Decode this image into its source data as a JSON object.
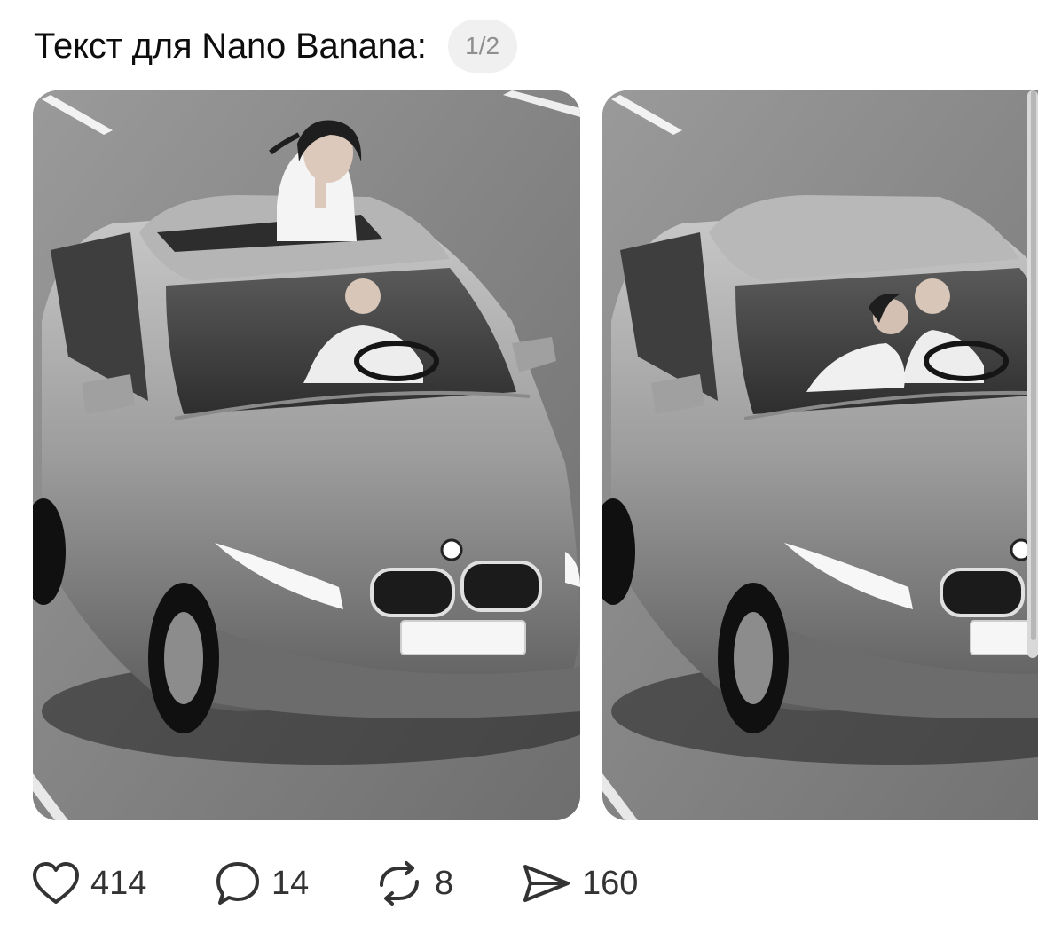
{
  "post": {
    "title": "Текст для Nano Banana:",
    "page_counter": "1/2"
  },
  "carousel": {
    "images": [
      {
        "description_name": "car-photo-woman-in-sunroof"
      },
      {
        "description_name": "car-photo-couple-inside"
      }
    ]
  },
  "actions": {
    "likes": "414",
    "comments": "14",
    "reposts": "8",
    "shares": "160"
  },
  "icons": {
    "like": "heart-icon",
    "comment": "speech-bubble-icon",
    "repost": "repost-arrows-icon",
    "share": "paper-plane-icon"
  }
}
